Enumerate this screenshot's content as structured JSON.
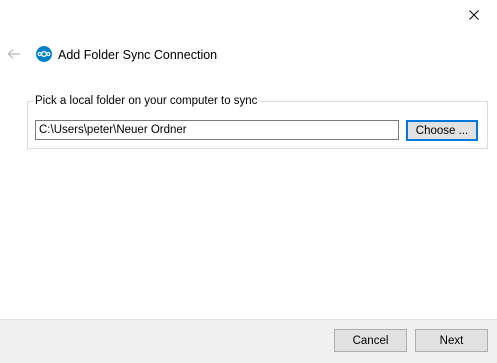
{
  "window": {
    "close_icon": "close-icon"
  },
  "header": {
    "back_icon": "back-arrow-icon",
    "app_icon": "nextcloud-logo-icon",
    "title": "Add Folder Sync Connection",
    "accent_color": "#0082c9"
  },
  "folder_group": {
    "label": "Pick a local folder on your computer to sync",
    "path_value": "C:\\Users\\peter\\Neuer Ordner",
    "choose_label": "Choose ..."
  },
  "footer": {
    "cancel_label": "Cancel",
    "next_label": "Next"
  }
}
